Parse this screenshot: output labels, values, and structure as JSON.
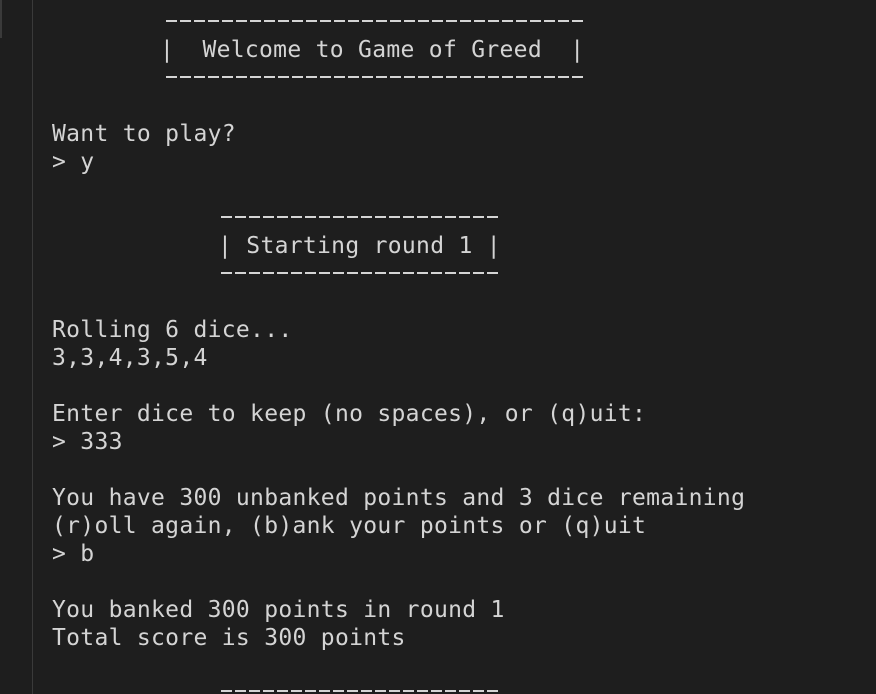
{
  "welcome_box": {
    "text": "|  Welcome to Game of Greed  |"
  },
  "prompts": {
    "want_to_play": "Want to play?",
    "want_to_play_input": "> y"
  },
  "round_box": {
    "text": "| Starting round 1 |"
  },
  "roll": {
    "rolling": "Rolling 6 dice...",
    "dice": "3,3,4,3,5,4",
    "keep_prompt": "Enter dice to keep (no spaces), or (q)uit:",
    "keep_input": "> 333"
  },
  "status": {
    "unbanked": "You have 300 unbanked points and 3 dice remaining",
    "options": "(r)oll again, (b)ank your points or (q)uit",
    "choice_input": "> b"
  },
  "banked": {
    "message": "You banked 300 points in round 1",
    "total": "Total score is 300 points"
  }
}
